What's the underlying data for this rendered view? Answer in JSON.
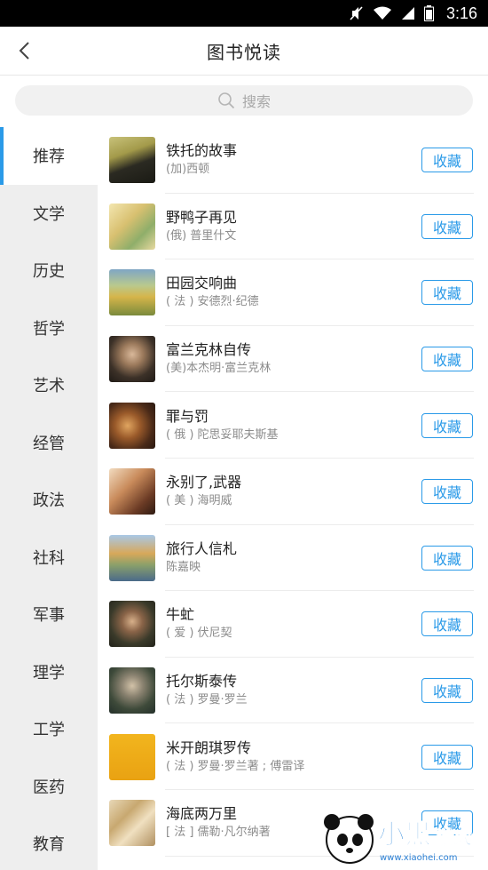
{
  "status": {
    "time": "3:16"
  },
  "header": {
    "title": "图书悦读"
  },
  "search": {
    "placeholder": "搜索"
  },
  "categories": [
    {
      "label": "推荐",
      "active": true
    },
    {
      "label": "文学"
    },
    {
      "label": "历史"
    },
    {
      "label": "哲学"
    },
    {
      "label": "艺术"
    },
    {
      "label": "经管"
    },
    {
      "label": "政法"
    },
    {
      "label": "社科"
    },
    {
      "label": "军事"
    },
    {
      "label": "理学"
    },
    {
      "label": "工学"
    },
    {
      "label": "医药"
    },
    {
      "label": "教育"
    }
  ],
  "books": [
    {
      "title": "铁托的故事",
      "author": "(加)西顿",
      "action": "收藏",
      "cover": "c1"
    },
    {
      "title": "野鸭子再见",
      "author": "(俄) 普里什文",
      "action": "收藏",
      "cover": "c2"
    },
    {
      "title": "田园交响曲",
      "author": "( 法 ) 安德烈·纪德",
      "action": "收藏",
      "cover": "c3"
    },
    {
      "title": "富兰克林自传",
      "author": "(美)本杰明·富兰克林",
      "action": "收藏",
      "cover": "c4"
    },
    {
      "title": "罪与罚",
      "author": "( 俄 ) 陀思妥耶夫斯基",
      "action": "收藏",
      "cover": "c5"
    },
    {
      "title": "永别了,武器",
      "author": "( 美 ) 海明威",
      "action": "收藏",
      "cover": "c6"
    },
    {
      "title": "旅行人信札",
      "author": "陈嘉映",
      "action": "收藏",
      "cover": "c7"
    },
    {
      "title": "牛虻",
      "author": "( 爱 ) 伏尼契",
      "action": "收藏",
      "cover": "c8"
    },
    {
      "title": "托尔斯泰传",
      "author": "( 法 ) 罗曼·罗兰",
      "action": "收藏",
      "cover": "c9"
    },
    {
      "title": "米开朗琪罗传",
      "author": "( 法 ) 罗曼·罗兰著 ; 傅雷译",
      "action": "收藏",
      "cover": "c10"
    },
    {
      "title": "海底两万里",
      "author": "[ 法 ] 儒勒·凡尔纳著",
      "action": "收藏",
      "cover": "c11"
    }
  ],
  "watermark": {
    "brand": "小黑游戏",
    "url": "www.xiaohei.com"
  },
  "colors": {
    "accent": "#2a9ae8",
    "sidebar_bg": "#eeeeee"
  }
}
